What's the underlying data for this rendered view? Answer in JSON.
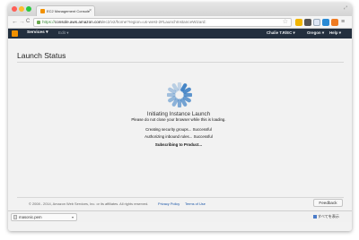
{
  "browser": {
    "tab_title": "EC2 Management Console",
    "tab_close": "×",
    "url_prefix": "https://",
    "url_host": "console.aws.amazon.com",
    "url_path": "/ec2/v2/home?region=us-west-2#LaunchInstanceWizard:",
    "back_glyph": "←",
    "forward_glyph": "→",
    "reload_glyph": "C",
    "star_glyph": "☆",
    "menu_glyph": "≡",
    "corner_glyph": "⤢"
  },
  "aws_nav": {
    "services": "Services ▾",
    "edit": "Edit ▾",
    "user": "Chalie T.R/EC ▾",
    "region": "Oregon ▾",
    "help": "Help ▾"
  },
  "page": {
    "title": "Launch Status",
    "status_heading": "Initiating Instance Launch",
    "status_sub": "Please do not close your browser while this is loading.",
    "steps": [
      {
        "text": "Creating security groups... Successful"
      },
      {
        "text": "Authorizing inbound rules... Successful"
      },
      {
        "text": "Subscribing to Product..."
      }
    ]
  },
  "footer": {
    "copyright": "© 2008 - 2014, Amazon Web Services, Inc. or its affiliates. All rights reserved.",
    "privacy": "Privacy Policy",
    "terms": "Terms of Use",
    "feedback": "Feedback"
  },
  "downloads": {
    "file": "masonic.pem",
    "chevron": "▾",
    "show_all": "すべてを表示"
  },
  "colors": {
    "aws_nav": "#232f3e",
    "aws_orange": "#f29100",
    "link_blue": "#1a55a6",
    "spinner_blue": "#3b7fc4"
  }
}
